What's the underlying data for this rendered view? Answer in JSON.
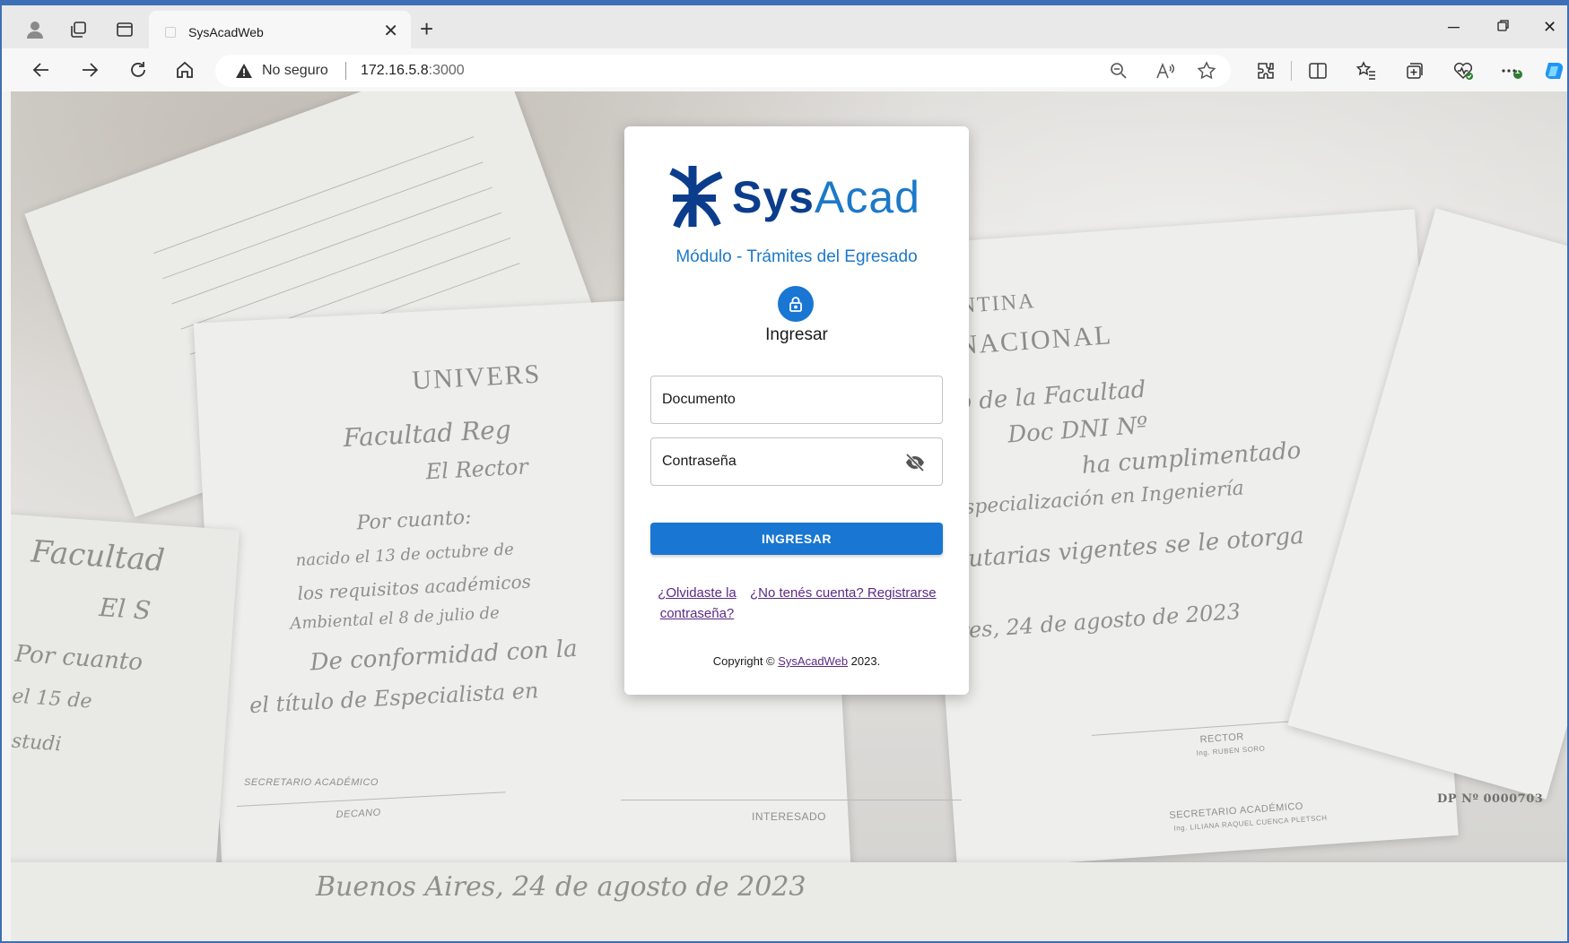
{
  "browser": {
    "tab_title": "SysAcadWeb",
    "new_tab_label": "+",
    "security_label": "No seguro",
    "url_host": "172.16.5.8",
    "url_port": ":3000",
    "icons": [
      "profile-icon",
      "workspaces-icon",
      "tab-actions-icon",
      "close-tab-icon",
      "back-icon",
      "forward-icon",
      "refresh-icon",
      "home-icon",
      "warning-icon",
      "zoom-out-icon",
      "read-aloud-icon",
      "favorite-icon",
      "extensions-icon",
      "split-screen-icon",
      "favorites-icon",
      "collections-icon",
      "browser-essentials-icon",
      "more-icon",
      "copilot-icon"
    ],
    "notification_count": "1"
  },
  "background": {
    "doc_text_1": "UNIVERS",
    "doc_text_2": "A NACIONAL",
    "doc_text_3": "ENTINA",
    "script_1": "Facultad Reg",
    "script_2": "El Rector",
    "script_3": "Por cuanto:",
    "script_4": "nacido el 13 de octubre de",
    "script_5": "los requisitos académicos",
    "script_6": "Ambiental el 8 de julio de",
    "script_7": "De conformidad con la",
    "script_8": "el título de Especialista en",
    "script_9": "no de la Facultad",
    "script_10": "Doc DNI Nº",
    "script_11": "ha cumplimentado",
    "script_12": "Especialización en Ingeniería",
    "script_13": "tatutarias vigentes se le otorga",
    "script_14": "res, 24 de agosto de 2023",
    "script_15": "Buenos Aires, 24 de agosto de 2023",
    "script_16": "Facultad",
    "script_17": "El S",
    "script_18": "Por cuanto",
    "script_19": "el 15 de",
    "script_20": "estudi",
    "sig_decano": "DECANO",
    "sig_secretario": "SECRETARIO ACADÉMICO",
    "sig_interesado": "INTERESADO",
    "sig_rector": "RECTOR",
    "sig_rector_name": "Ing. RUBEN SORO",
    "sig_secretario_r": "SECRETARIO ACADÉMICO",
    "sig_secretario_r_name": "Ing. LILIANA RAQUEL CUENCA PLETSCH",
    "doc_number": "DP Nº 0000703"
  },
  "login": {
    "logo_sys": "Sys",
    "logo_acad": "Acad",
    "module_title": "Módulo - Trámites del Egresado",
    "heading": "Ingresar",
    "document_placeholder": "Documento",
    "password_placeholder": "Contraseña",
    "submit_label": "INGRESAR",
    "forgot_label": "¿Olvidaste la contraseña?",
    "register_label": "¿No tenés cuenta? Registrarse",
    "copyright_prefix": "Copyright © ",
    "copyright_link": "SysAcadWeb",
    "copyright_suffix": " 2023.",
    "colors": {
      "primary": "#1976d2",
      "logo_dark": "#0b3d8c",
      "logo_light": "#1c79c8",
      "link": "#5b2a86"
    }
  }
}
